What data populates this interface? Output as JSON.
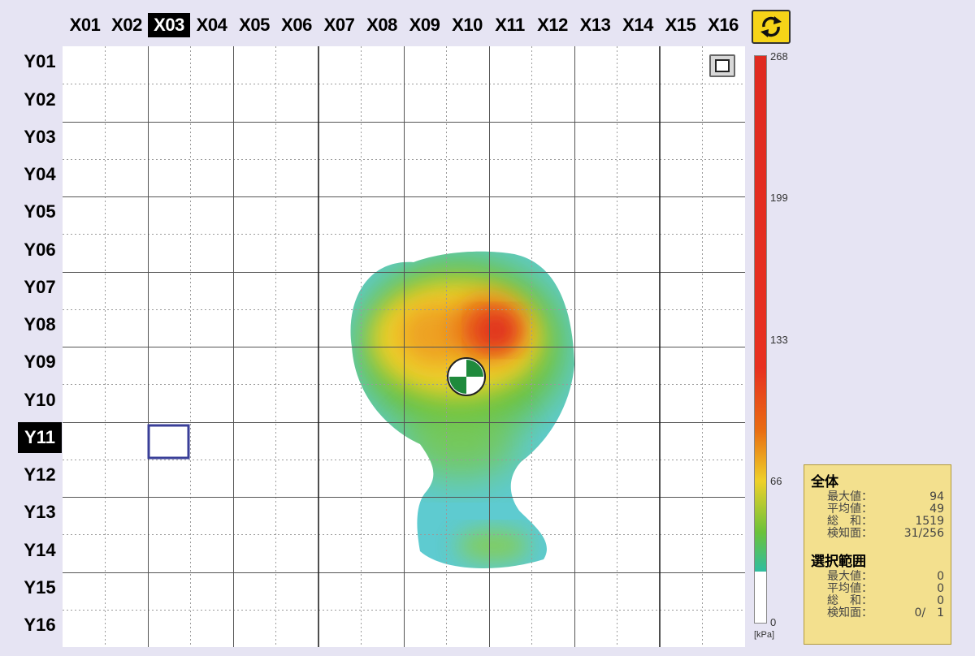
{
  "columns": [
    "X01",
    "X02",
    "X03",
    "X04",
    "X05",
    "X06",
    "X07",
    "X08",
    "X09",
    "X10",
    "X11",
    "X12",
    "X13",
    "X14",
    "X15",
    "X16"
  ],
  "rows": [
    "Y01",
    "Y02",
    "Y03",
    "Y04",
    "Y05",
    "Y06",
    "Y07",
    "Y08",
    "Y09",
    "Y10",
    "Y11",
    "Y12",
    "Y13",
    "Y14",
    "Y15",
    "Y16"
  ],
  "selected_column": "X03",
  "selected_row": "Y11",
  "icons": {
    "refresh": "refresh-cycle-icon",
    "view_toggle": "square-icon",
    "center": "center-of-pressure-icon"
  },
  "colors": {
    "low": "#5ecbd0",
    "mid_low": "#6bc23a",
    "mid": "#eed02a",
    "mid_high": "#e96c12",
    "high": "#e02a20",
    "selection": "#3a3f98"
  },
  "scale": {
    "ticks": [
      "268",
      "199",
      "133",
      "66",
      "0"
    ],
    "unit": "[kPa]"
  },
  "stats": {
    "overall": {
      "title": "全体",
      "rows": [
        {
          "label": "最大値：",
          "value": "94"
        },
        {
          "label": "平均値：",
          "value": "49"
        },
        {
          "label": "総　和：",
          "value": "1519"
        },
        {
          "label": "検知面：",
          "value": "31/256"
        }
      ]
    },
    "selection": {
      "title": "選択範囲",
      "rows": [
        {
          "label": "最大値：",
          "value": "0"
        },
        {
          "label": "平均値：",
          "value": "0"
        },
        {
          "label": "総　和：",
          "value": "0"
        },
        {
          "label": "検知面：",
          "value": "0/　1"
        }
      ]
    }
  }
}
